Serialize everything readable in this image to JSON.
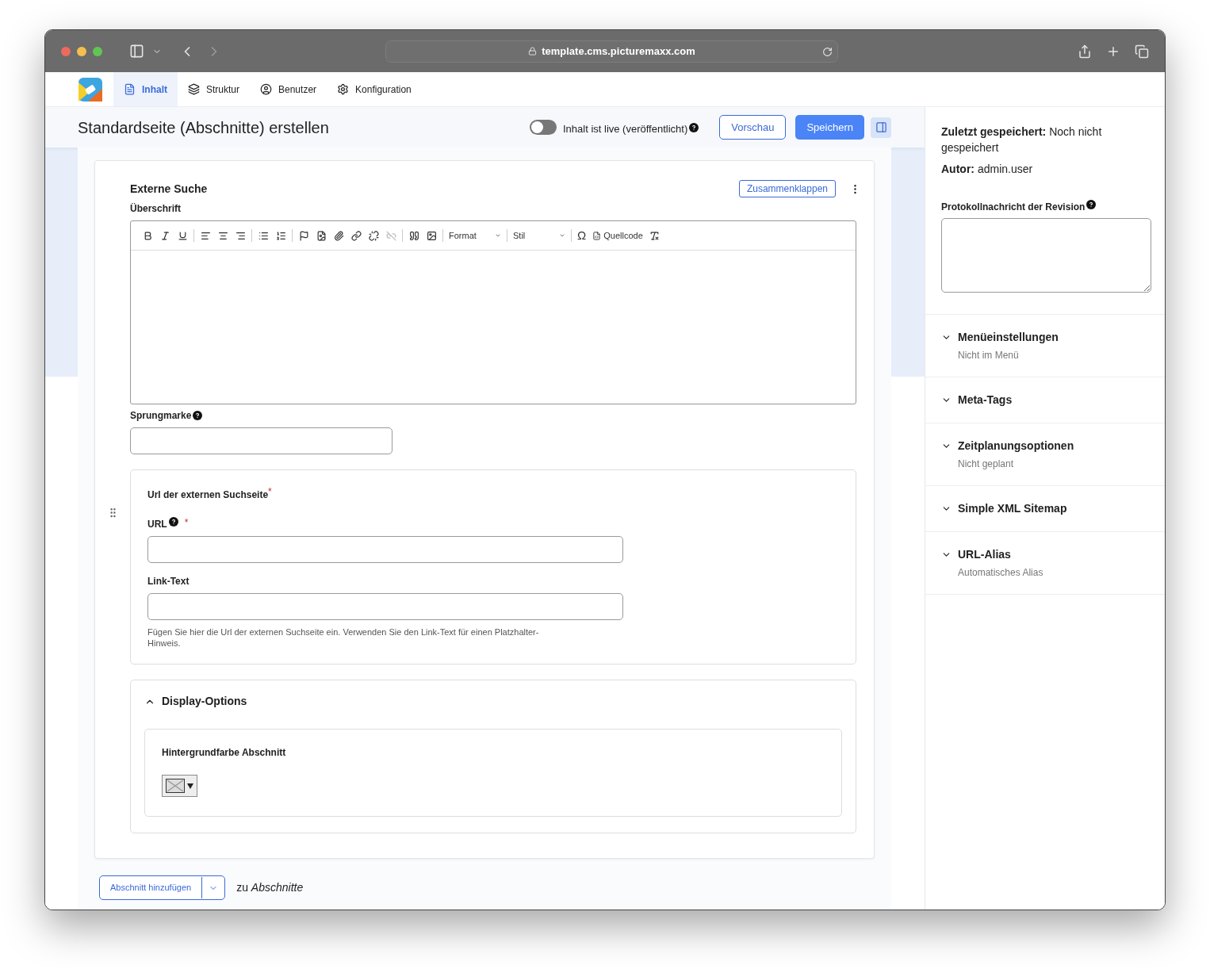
{
  "browser": {
    "url": "template.cms.picturemaxx.com"
  },
  "nav": {
    "tabs": [
      {
        "label": "Inhalt",
        "selected": true
      },
      {
        "label": "Struktur",
        "selected": false
      },
      {
        "label": "Benutzer",
        "selected": false
      },
      {
        "label": "Konfiguration",
        "selected": false
      }
    ]
  },
  "header": {
    "title": "Standardseite (Abschnitte) erstellen",
    "live_toggle": {
      "label": "Inhalt ist live (veröffentlicht)",
      "on": false
    },
    "preview_button": "Vorschau",
    "save_button": "Speichern"
  },
  "section": {
    "title": "Externe Suche",
    "collapse_button": "Zusammenklappen",
    "heading_label": "Überschrift",
    "toolbar": {
      "format_dropdown": "Format",
      "style_dropdown": "Stil",
      "special_char": "Ω",
      "source_button": "Quellcode"
    },
    "anchor_label": "Sprungmarke",
    "url_group": {
      "legend": "Url der externen Suchseite",
      "required_mark": "*",
      "url_label": "URL",
      "url_required_mark": "*",
      "link_text_label": "Link-Text",
      "description": "Fügen Sie hier die Url der externen Suchseite ein. Verwenden Sie den Link-Text für einen Platzhalter-Hinweis."
    },
    "display_options": {
      "title": "Display-Options",
      "expanded": true,
      "background_label": "Hintergrundfarbe Abschnitt"
    }
  },
  "add_section": {
    "button": "Abschnitt hinzufügen",
    "suffix": "zu *Abschnitte*"
  },
  "sidebar": {
    "last_saved_label": "Zuletzt gespeichert:",
    "last_saved_value": "Noch nicht gespeichert",
    "author_label": "Autor:",
    "author_value": "admin.user",
    "revision_label": "Protokollnachricht der Revision",
    "panels": [
      {
        "title": "Menüeinstellungen",
        "summary": "Nicht im Menü",
        "expanded": false
      },
      {
        "title": "Meta-Tags",
        "expanded": false
      },
      {
        "title": "Zeitplanungsoptionen",
        "summary": "Nicht geplant",
        "expanded": false
      },
      {
        "title": "Simple XML Sitemap",
        "expanded": false
      },
      {
        "title": "URL-Alias",
        "summary": "Automatisches Alias",
        "expanded": false
      }
    ]
  }
}
